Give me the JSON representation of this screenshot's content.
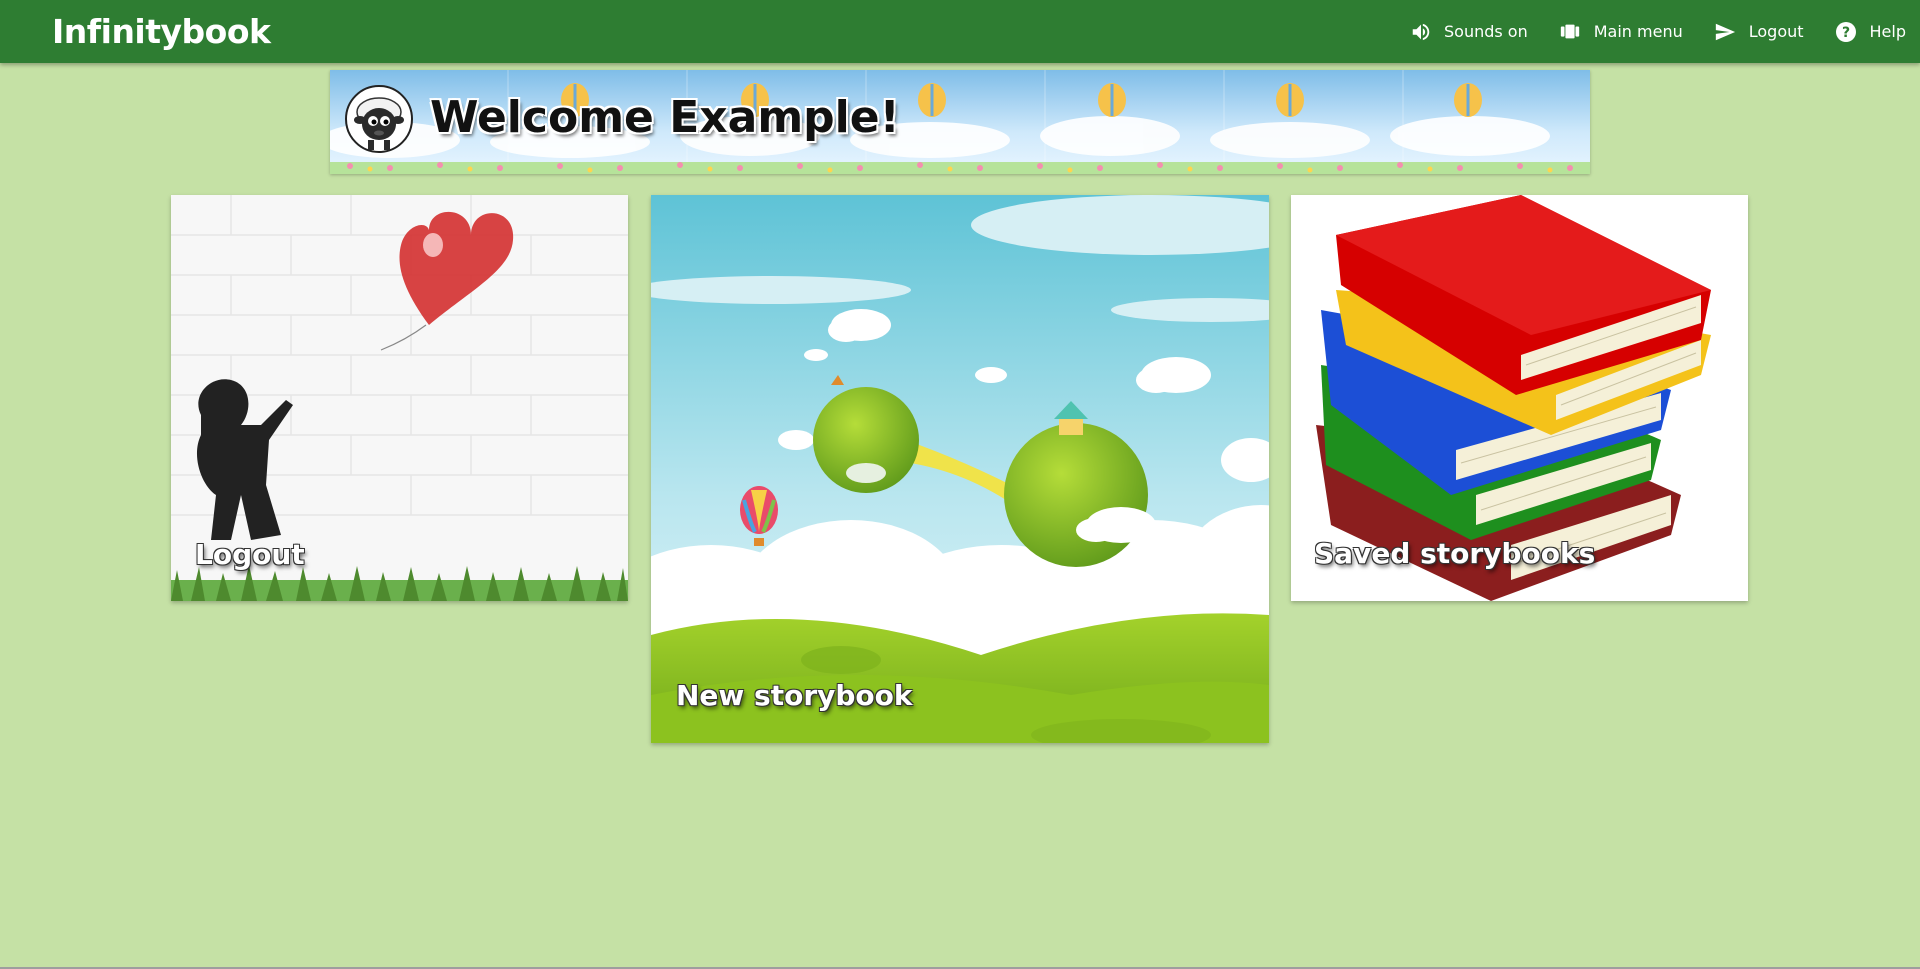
{
  "app": {
    "brand": "Infinitybook"
  },
  "nav": {
    "items": [
      {
        "label": "Sounds on",
        "icon": "speaker-icon"
      },
      {
        "label": "Main menu",
        "icon": "carousel-icon"
      },
      {
        "label": "Logout",
        "icon": "send-icon"
      },
      {
        "label": "Help",
        "icon": "help-icon"
      }
    ]
  },
  "banner": {
    "title": "Welcome Example!",
    "mascot": "sheep-icon"
  },
  "cards": {
    "logout": {
      "label": "Logout"
    },
    "new_storybook": {
      "label": "New storybook"
    },
    "saved_storybooks": {
      "label": "Saved storybooks"
    }
  },
  "colors": {
    "topbar": "#2e7d32",
    "background": "#c5e1a5",
    "text_light": "#ffffff"
  }
}
